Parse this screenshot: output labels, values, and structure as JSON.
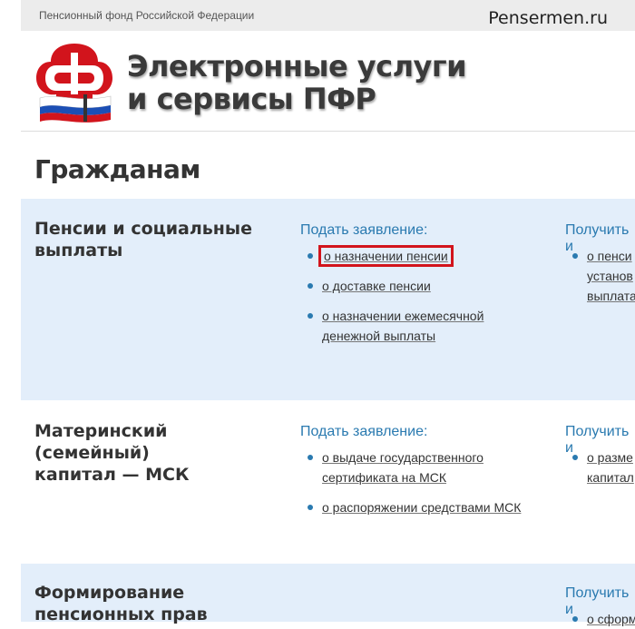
{
  "topbar": {
    "org_name": "Пенсионный фонд Российской Федерации"
  },
  "watermark": "Pensermen.ru",
  "header": {
    "logo_icon": "pfr-logo-icon",
    "title_line1": "Электронные услуги",
    "title_line2": "и сервисы ПФР"
  },
  "section": {
    "heading": "Гражданам"
  },
  "blocks": [
    {
      "title_line1": "Пенсии и социальные",
      "title_line2": "выплаты",
      "col1_head": "Подать заявление:",
      "col1_links": [
        {
          "label": "о назначении пенсии"
        },
        {
          "label": "о доставке пенсии"
        },
        {
          "line1": "о назначении ежемесячной",
          "line2": "денежной выплаты"
        }
      ],
      "col2_head": "Получить и",
      "col2_links": [
        {
          "line1": "о пенси",
          "line2": "установ",
          "line3": "выплата"
        }
      ]
    },
    {
      "title_line1": "Материнский (семейный)",
      "title_line2": "капитал — МСК",
      "col1_head": "Подать заявление:",
      "col1_links": [
        {
          "line1": "о выдаче государственного",
          "line2": "сертификата на МСК"
        },
        {
          "label": "о распоряжении средствами МСК"
        }
      ],
      "col2_head": "Получить и",
      "col2_links": [
        {
          "line1": "о разме",
          "line2": "капитал"
        }
      ]
    },
    {
      "title_line1": "Формирование",
      "title_line2": "пенсионных прав",
      "col2_head": "Получить и",
      "col2_links": [
        {
          "label": "о сформ"
        }
      ]
    }
  ],
  "colors": {
    "accent_blue": "#2a7ab0",
    "band_blue": "#e3eefa",
    "highlight_red": "#d2141c"
  }
}
